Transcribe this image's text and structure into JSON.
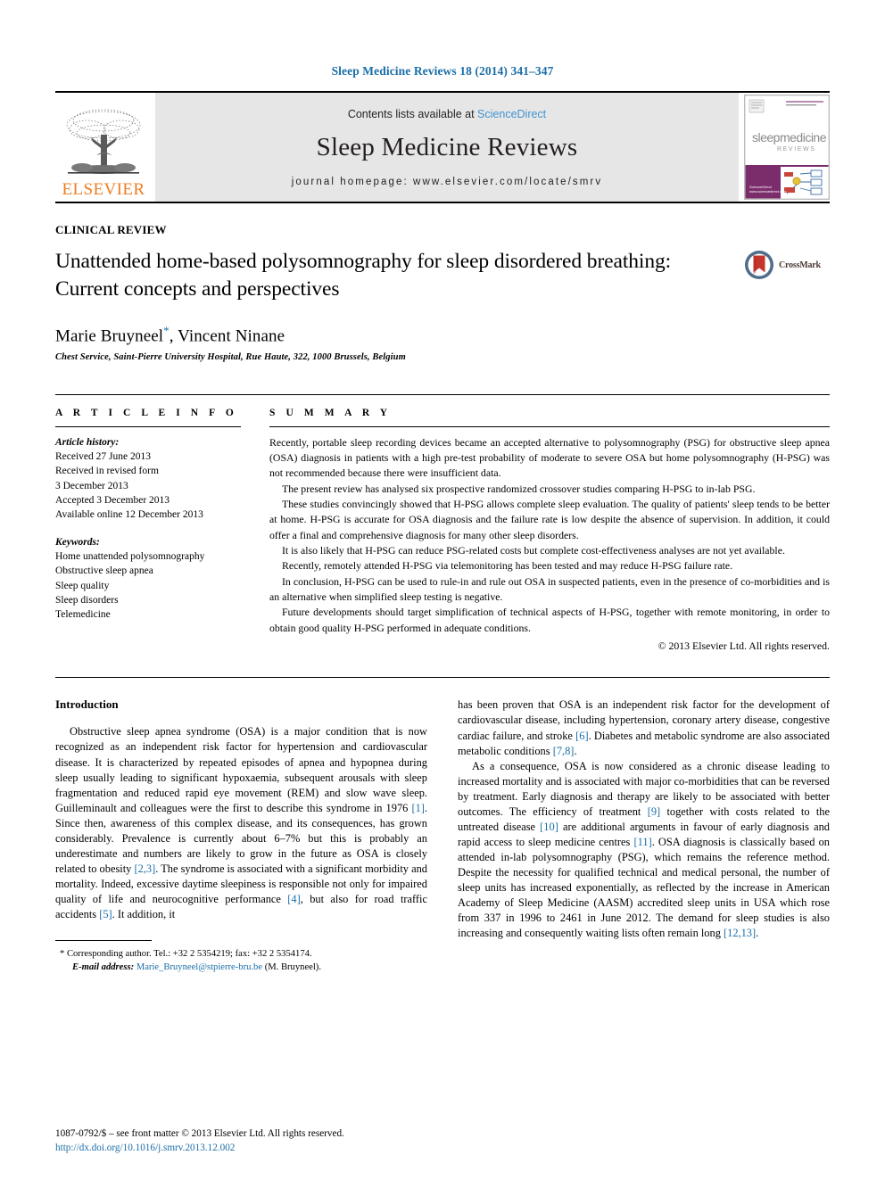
{
  "running_head": "Sleep Medicine Reviews 18 (2014) 341–347",
  "masthead": {
    "publisher_name": "ELSEVIER",
    "contents_prefix": "Contents lists available at ",
    "contents_link": "ScienceDirect",
    "journal_title": "Sleep Medicine Reviews",
    "homepage_label": "journal homepage: www.elsevier.com/locate/smrv",
    "cover": {
      "line1": "sleepmedicine",
      "line2": "REVIEWS"
    }
  },
  "article": {
    "kicker": "CLINICAL REVIEW",
    "title": "Unattended home-based polysomnography for sleep disordered breathing: Current concepts and perspectives",
    "crossmark_label": "CrossMark",
    "authors_html": "Marie Bruyneel<sup>*</sup>, Vincent Ninane",
    "affiliation": "Chest Service, Saint-Pierre University Hospital, Rue Haute, 322, 1000 Brussels, Belgium"
  },
  "article_info": {
    "heading": "A R T I C L E   I N F O",
    "history_label": "Article history:",
    "history": [
      "Received 27 June 2013",
      "Received in revised form",
      "3 December 2013",
      "Accepted 3 December 2013",
      "Available online 12 December 2013"
    ],
    "keywords_label": "Keywords:",
    "keywords": [
      "Home unattended polysomnography",
      "Obstructive sleep apnea",
      "Sleep quality",
      "Sleep disorders",
      "Telemedicine"
    ]
  },
  "summary": {
    "heading": "S U M M A R Y",
    "paragraphs": [
      "Recently, portable sleep recording devices became an accepted alternative to polysomnography (PSG) for obstructive sleep apnea (OSA) diagnosis in patients with a high pre-test probability of moderate to severe OSA but home polysomnography (H-PSG) was not recommended because there were insufficient data.",
      "The present review has analysed six prospective randomized crossover studies comparing H-PSG to in-lab PSG.",
      "These studies convincingly showed that H-PSG allows complete sleep evaluation. The quality of patients' sleep tends to be better at home. H-PSG is accurate for OSA diagnosis and the failure rate is low despite the absence of supervision. In addition, it could offer a final and comprehensive diagnosis for many other sleep disorders.",
      "It is also likely that H-PSG can reduce PSG-related costs but complete cost-effectiveness analyses are not yet available.",
      "Recently, remotely attended H-PSG via telemonitoring has been tested and may reduce H-PSG failure rate.",
      "In conclusion, H-PSG can be used to rule-in and rule out OSA in suspected patients, even in the presence of co-morbidities and is an alternative when simplified sleep testing is negative.",
      "Future developments should target simplification of technical aspects of H-PSG, together with remote monitoring, in order to obtain good quality H-PSG performed in adequate conditions."
    ],
    "copyright": "© 2013 Elsevier Ltd. All rights reserved."
  },
  "body": {
    "intro_heading": "Introduction",
    "left_paragraphs_html": [
      "Obstructive sleep apnea syndrome (OSA) is a major condition that is now recognized as an independent risk factor for hypertension and cardiovascular disease. It is characterized by repeated episodes of apnea and hypopnea during sleep usually leading to significant hypoxaemia, subsequent arousals with sleep fragmentation and reduced rapid eye movement (REM) and slow wave sleep. Guilleminault and colleagues were the first to describe this syndrome in 1976 <span class=\"ref\">[1]</span>. Since then, awareness of this complex disease, and its consequences, has grown considerably. Prevalence is currently about 6–7% but this is probably an underestimate and numbers are likely to grow in the future as OSA is closely related to obesity <span class=\"ref\">[2,3]</span>. The syndrome is associated with a significant morbidity and mortality. Indeed, excessive daytime sleepiness is responsible not only for impaired quality of life and neurocognitive performance <span class=\"ref\">[4]</span>, but also for road traffic accidents <span class=\"ref\">[5]</span>. It addition, it"
    ],
    "right_paragraphs_html": [
      "has been proven that OSA is an independent risk factor for the development of cardiovascular disease, including hypertension, coronary artery disease, congestive cardiac failure, and stroke <span class=\"ref\">[6]</span>. Diabetes and metabolic syndrome are also associated metabolic conditions <span class=\"ref\">[7,8]</span>.",
      "As a consequence, OSA is now considered as a chronic disease leading to increased mortality and is associated with major co-morbidities that can be reversed by treatment. Early diagnosis and therapy are likely to be associated with better outcomes. The efficiency of treatment <span class=\"ref\">[9]</span> together with costs related to the untreated disease <span class=\"ref\">[10]</span> are additional arguments in favour of early diagnosis and rapid access to sleep medicine centres <span class=\"ref\">[11]</span>. OSA diagnosis is classically based on attended in-lab polysomnography (PSG), which remains the reference method. Despite the necessity for qualified technical and medical personal, the number of sleep units has increased exponentially, as reflected by the increase in American Academy of Sleep Medicine (AASM) accredited sleep units in USA which rose from 337 in 1996 to 2461 in June 2012. The demand for sleep studies is also increasing and consequently waiting lists often remain long <span class=\"ref\">[12,13]</span>."
    ]
  },
  "footnote": {
    "corresponding": "* Corresponding author. Tel.: +32 2 5354219; fax: +32 2 5354174.",
    "email_label": "E-mail address:",
    "email": "Marie_Bruyneel@stpierre-bru.be",
    "email_suffix": "(M. Bruyneel)."
  },
  "page_footer": {
    "issn_line": "1087-0792/$ – see front matter © 2013 Elsevier Ltd. All rights reserved.",
    "doi": "http://dx.doi.org/10.1016/j.smrv.2013.12.002"
  },
  "colors": {
    "link_blue": "#1a6ea8",
    "sciencedirect_blue": "#3f93cf",
    "elsevier_orange": "#ef7d22",
    "masthead_gray": "#e6e6e6"
  }
}
